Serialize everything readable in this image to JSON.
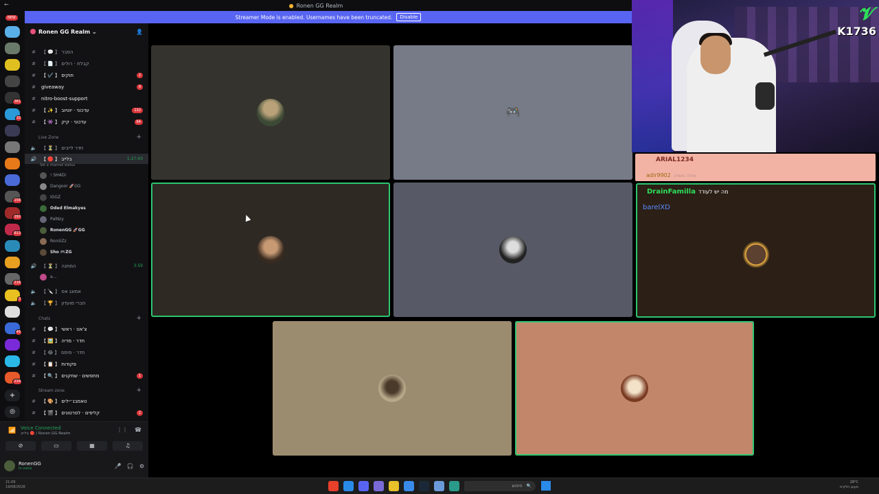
{
  "titlebar": {
    "title": "Ronen GG Realm"
  },
  "banner": {
    "text": "Streamer Mode is enabled. Usernames have been truncated.",
    "button": "Disable"
  },
  "guilds": {
    "new_badge": "NEW",
    "badges": [
      "381",
      "10",
      "158",
      "192",
      "813",
      "218",
      "3",
      "49",
      "234"
    ]
  },
  "server": {
    "name": "Ronen GG Realm"
  },
  "channels": [
    {
      "label": "【 💬 】 הסבר",
      "count": ""
    },
    {
      "label": "【 📄 】 קבלת · רולים",
      "count": ""
    },
    {
      "label": "【 ✔️ 】 חוקים",
      "count": "2"
    },
    {
      "label": "giveaway",
      "count": "9"
    },
    {
      "label": "nitro-boost-support",
      "count": ""
    },
    {
      "label": "【 ✨ 】 עדכוני · יוטיוב",
      "count": "132"
    },
    {
      "label": "【 👾 】 עדכוני · קיק",
      "count": "64"
    }
  ],
  "live_zone": {
    "category": "Live Zone",
    "waiting_room": "【 ⏳ 】 חדר לייבים",
    "live_channel": "【 🔴 】 בלייב",
    "live_timer": "1:27:43",
    "status_hint": "Set a channel status",
    "users": [
      {
        "name": "! SHADi",
        "bold": false,
        "color": "#555"
      },
      {
        "name": "Dangoor 🚀GG",
        "bold": false,
        "color": "#888"
      },
      {
        "name": "IGGZ",
        "bold": false,
        "color": "#444"
      },
      {
        "name": "Oded Elmakyes",
        "bold": true,
        "color": "#3a6b3a"
      },
      {
        "name": "PalNzy",
        "bold": false,
        "color": "#667"
      },
      {
        "name": "RonenGG 🚀GG",
        "bold": true,
        "color": "#4b5d3a"
      },
      {
        "name": "RoniiiZz",
        "bold": false,
        "color": "#8a6a55"
      },
      {
        "name": "Sho 🎮ZG",
        "bold": true,
        "color": "#5b4a3a"
      }
    ],
    "waiting_channel": "【 ⏳ 】 המתנה",
    "waiting_timer": "3:59",
    "waiting_user": "a...",
    "among_us": "【 🔪 】 אמונג אס",
    "friends": "【 🏆 】 חברי מועדון"
  },
  "chats": {
    "category": "Chats",
    "items": [
      {
        "label": "【 💬 】 צ'אט · ראשי",
        "count": ""
      },
      {
        "label": "【 🖼️ 】 חדר · מדיה",
        "count": ""
      },
      {
        "label": "【 😂 】 חדר · מימס",
        "count": ""
      },
      {
        "label": "【 📋 】 פקודות",
        "count": ""
      },
      {
        "label": "【 🔍 】 מחפשים · שחקנים",
        "count": "1"
      }
    ]
  },
  "stream_zone": {
    "category": "Stream zone",
    "items": [
      {
        "label": "【 🎨 】 טאמבנ״ילים",
        "count": ""
      },
      {
        "label": "【 🎬 】 קליפים · לסרטונים",
        "count": "2"
      }
    ]
  },
  "voice": {
    "status": "Voice Connected",
    "sub": "בלייב 🔴 / Ronen GG Realm"
  },
  "user": {
    "name": "RonenGG",
    "status": "In voice"
  },
  "webcam": {
    "logo": "𝓥",
    "tag": "K1736"
  },
  "chat_overlay": {
    "line1_user": "ARIAL1234",
    "line2_user": "adir9902",
    "line2_text": "אחלה משחק"
  },
  "right_tile": {
    "user": "DrainFamilla",
    "message": "מה יש לעודד",
    "user2": "barelXD"
  },
  "taskbar": {
    "time": "21:09",
    "date": "19/08/2026",
    "search": "חיפוש",
    "weather": "28°C",
    "weather_desc": "מעונן חלקית"
  },
  "colors": {
    "accent": "#5865f2",
    "speaking": "#2dc770",
    "voice_green": "#23a55a",
    "badge_red": "#da373c"
  }
}
